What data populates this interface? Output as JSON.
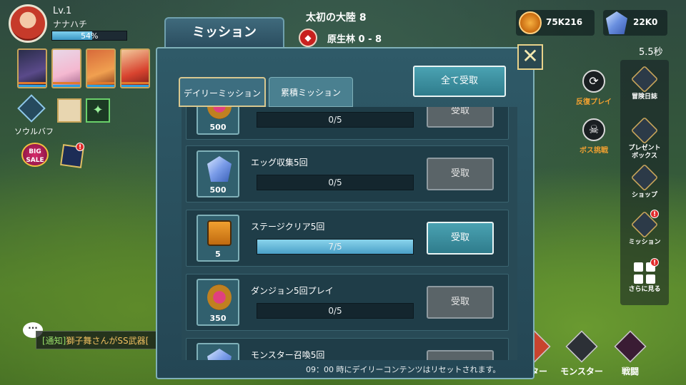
{
  "player": {
    "level": "Lv.1",
    "name": "ナナハチ",
    "exp_percent": "54%",
    "exp_fraction": 0.54
  },
  "left_menu": {
    "soul_buff_label": "ソウルバフ",
    "big_sale_label": "BIG SALE",
    "event_badge": "!"
  },
  "stage": {
    "continent": "太初の大陸 8",
    "area": "原生林 0 - 8"
  },
  "currency": {
    "gold": "75K216",
    "gems": "22K0"
  },
  "timer": "5.5秒",
  "right_side": {
    "replay_label": "反復プレイ",
    "boss_label": "ボス挑戦",
    "menu": [
      {
        "label": "冒険日誌",
        "icon": "journal-icon"
      },
      {
        "label": "プレゼント\nボックス",
        "icon": "gift-icon"
      },
      {
        "label": "ショップ",
        "icon": "shop-icon"
      },
      {
        "label": "ミッション",
        "icon": "mission-icon",
        "badge": "!"
      },
      {
        "label": "さらに見る",
        "icon": "more-icon",
        "badge": "!"
      }
    ]
  },
  "chat": {
    "tag": "[通知]",
    "text": "獅子舞さんがSS武器["
  },
  "bottom_bar": {
    "hero_label": "ンター",
    "monster_label": "モンスター",
    "battle_label": "戦闘"
  },
  "modal": {
    "title": "ミッション",
    "close": "✕",
    "tabs": [
      "デイリーミッション",
      "累積ミッション"
    ],
    "claim_all": "全て受取",
    "reset_note": "09：00 時にデイリーコンテンツはリセットされます。",
    "missions": [
      {
        "title": "",
        "reward_icon": "pink-gem-coin-icon",
        "reward": "500",
        "progress": "0/5",
        "fraction": 0,
        "button": "受取",
        "state": "disabled"
      },
      {
        "title": "エッグ収集5回",
        "reward_icon": "blue-gem-icon",
        "reward": "500",
        "progress": "0/5",
        "fraction": 0,
        "button": "受取",
        "state": "disabled"
      },
      {
        "title": "ステージクリア5回",
        "reward_icon": "ticket-icon",
        "reward": "5",
        "progress": "7/5",
        "fraction": 1,
        "button": "受取",
        "state": "active"
      },
      {
        "title": "ダンジョン5回プレイ",
        "reward_icon": "pink-gem-coin-icon",
        "reward": "350",
        "progress": "0/5",
        "fraction": 0,
        "button": "受取",
        "state": "disabled"
      },
      {
        "title": "モンスター召喚5回",
        "reward_icon": "blue-gem-icon",
        "reward": "",
        "progress": "",
        "fraction": 0,
        "button": "",
        "state": "disabled"
      }
    ]
  }
}
